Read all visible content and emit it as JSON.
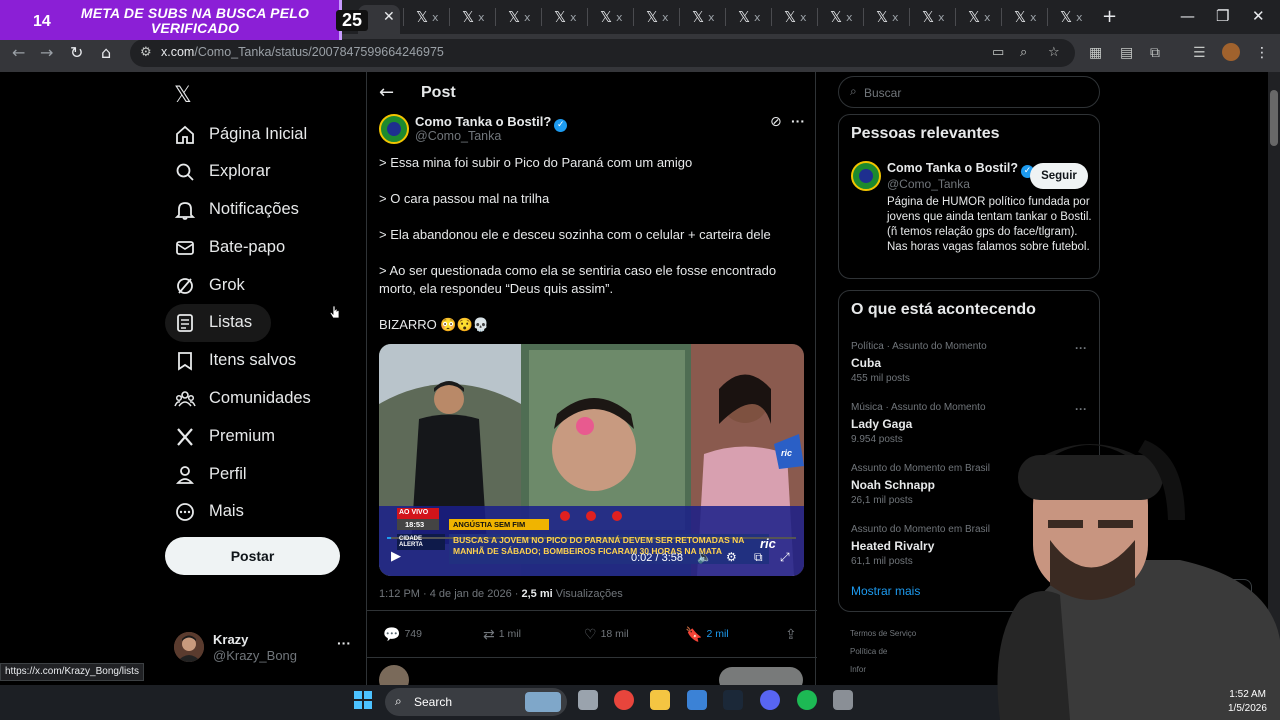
{
  "overlay": {
    "subs_number": "14",
    "subs_text": "META DE SUBS NA BUSCA PELO VERIFICADO",
    "badge": "25"
  },
  "browser": {
    "tab_close": "✕",
    "x_tab_glyph": "𝕏",
    "x_tab_suffix": "x",
    "new_tab": "+",
    "url_host": "x.com",
    "url_path": "/Como_Tanka/status/2007847599664246975",
    "status_url": "https://x.com/Krazy_Bong/lists"
  },
  "nav": {
    "logo": "𝕏",
    "items": [
      {
        "label": "Página Inicial",
        "icon": "home-icon"
      },
      {
        "label": "Explorar",
        "icon": "search-icon"
      },
      {
        "label": "Notificações",
        "icon": "bell-icon"
      },
      {
        "label": "Bate-papo",
        "icon": "mail-icon"
      },
      {
        "label": "Grok",
        "icon": "grok-icon"
      },
      {
        "label": "Listas",
        "icon": "list-icon"
      },
      {
        "label": "Itens salvos",
        "icon": "bookmark-icon"
      },
      {
        "label": "Comunidades",
        "icon": "communities-icon"
      },
      {
        "label": "Premium",
        "icon": "x-premium-icon"
      },
      {
        "label": "Perfil",
        "icon": "person-icon"
      },
      {
        "label": "Mais",
        "icon": "more-circle-icon"
      }
    ],
    "post_button": "Postar",
    "account": {
      "name": "Krazy",
      "handle": "@Krazy_Bong",
      "more": "···"
    }
  },
  "post": {
    "header": "Post",
    "back": "←",
    "author": {
      "name": "Como Tanka o Bostil?",
      "handle": "@Como_Tanka",
      "verified": "✓"
    },
    "more": "···",
    "lines": [
      "> Essa mina foi subir o Pico do Paraná com um amigo",
      "> O cara passou mal na trilha",
      "> Ela abandonou ele e desceu sozinha com o celular + carteira dele",
      "> Ao ser questionada como ela se sentiria caso ele fosse encontrado morto, ela respondeu “Deus quis assim”.",
      "BIZARRO 😳😯💀"
    ],
    "video": {
      "live_label": "AO VIVO",
      "clock": "18:53",
      "tag": "ANGÚSTIA SEM FIM",
      "corner_tag": "CIDADE ALERTA",
      "headline": "BUSCAS A JOVEM NO PICO DO PARANÁ DEVEM SER RETOMADAS NA MANHÃ DE SÁBADO; BOMBEIROS FICARAM 30 HORAS NA MATA",
      "time": "0:02 / 3:58",
      "progress": 0.01,
      "logo": "ric",
      "badge": "ric"
    },
    "timestamp": "1:12 PM · 4 de jan de 2026 · ",
    "views_count": "2,5 mi",
    "views_label": " Visualizações",
    "stats": {
      "replies": "749",
      "reposts": "1 mil",
      "likes": "18 mil",
      "bookmarks": "2 mil"
    }
  },
  "sidebar": {
    "search_placeholder": "Buscar",
    "relevant": {
      "title": "Pessoas relevantes",
      "name": "Como Tanka o Bostil?",
      "handle": "@Como_Tanka",
      "follow": "Seguir",
      "bio": "Página de HUMOR político fundada por jovens que ainda tentam tankar o Bostil. (ñ temos relação gps do face/tlgram). Nas horas vagas falamos sobre futebol."
    },
    "trends_title": "O que está acontecendo",
    "trends": [
      {
        "category": "Política · Assunto do Momento",
        "name": "Cuba",
        "count": "455 mil posts"
      },
      {
        "category": "Música · Assunto do Momento",
        "name": "Lady Gaga",
        "count": "9.954 posts"
      },
      {
        "category": "Assunto do Momento em Brasil",
        "name": "Noah Schnapp",
        "count": "26,1 mil posts"
      },
      {
        "category": "Assunto do Momento em Brasil",
        "name": "Heated Rivalry",
        "count": "61,1 mil posts"
      }
    ],
    "trend_more": "···",
    "show_more": "Mostrar mais",
    "footer": [
      "Termos de Serviço",
      "Política de",
      "Infor"
    ]
  },
  "taskbar": {
    "search": "Search",
    "time": "1:52 AM",
    "date": "1/5/2026"
  }
}
